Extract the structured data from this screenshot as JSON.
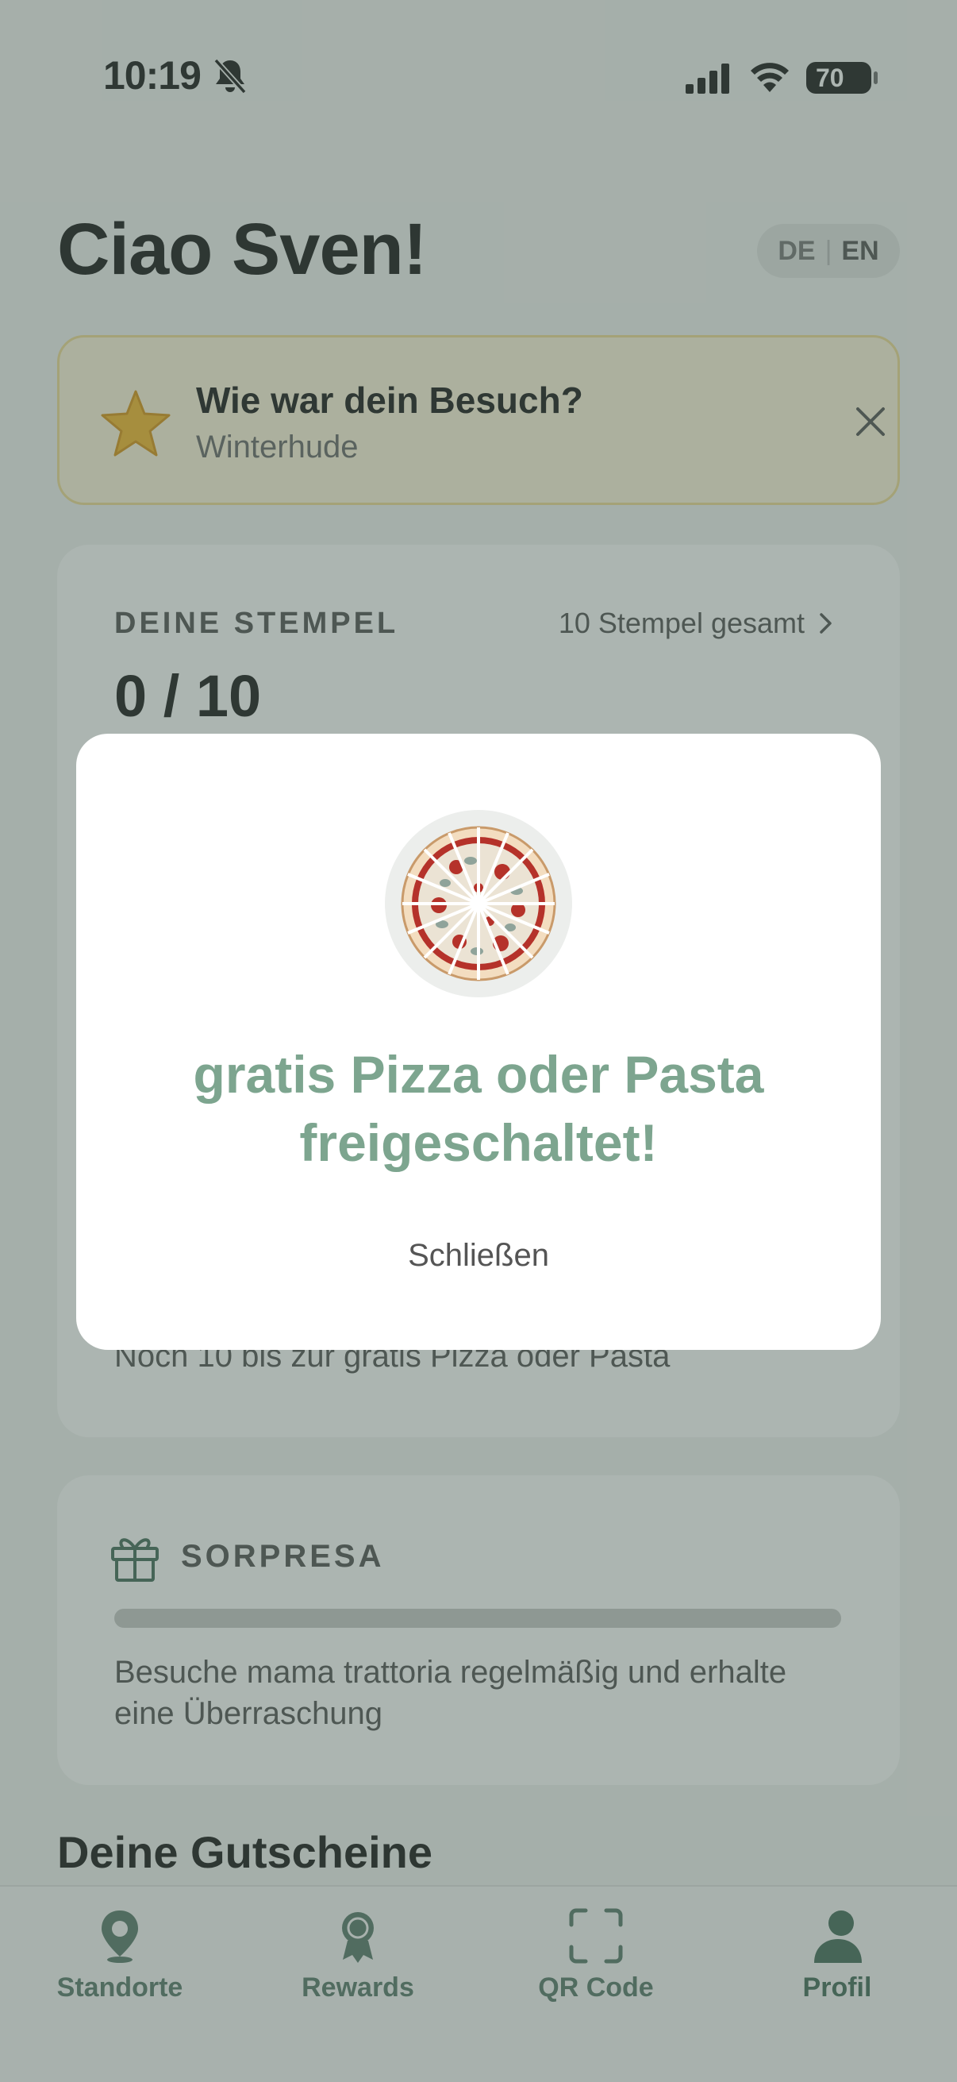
{
  "status_bar": {
    "time": "10:19",
    "battery": "70"
  },
  "header": {
    "greeting": "Ciao Sven!",
    "lang_de": "DE",
    "lang_sep": "|",
    "lang_en": "EN"
  },
  "review_prompt": {
    "title": "Wie war dein Besuch?",
    "location": "Winterhude"
  },
  "stamps": {
    "label": "DEINE STEMPEL",
    "total_link": "10 Stempel gesamt",
    "count": "0 / 10",
    "remaining": "Noch 10 bis zur gratis Pizza oder Pasta"
  },
  "surprise": {
    "label": "SORPRESA",
    "progress": 0,
    "description": "Besuche mama trattoria regelmäßig und erhalte eine Überraschung"
  },
  "vouchers": {
    "title": "Deine Gutscheine"
  },
  "tabbar": {
    "tabs": [
      {
        "label": "Standorte",
        "icon": "location-pin-icon"
      },
      {
        "label": "Rewards",
        "icon": "award-medal-icon"
      },
      {
        "label": "QR Code",
        "icon": "qr-scan-icon"
      },
      {
        "label": "Profil",
        "icon": "profile-person-icon"
      }
    ],
    "active_index": 3
  },
  "modal": {
    "headline": "gratis Pizza oder Pasta freigeschaltet!",
    "close_label": "Schließen"
  },
  "colors": {
    "accent_green": "#7da58f",
    "tab_green": "#5a7a6c",
    "review_bg": "#fff6dc",
    "star": "#f5b82e"
  }
}
